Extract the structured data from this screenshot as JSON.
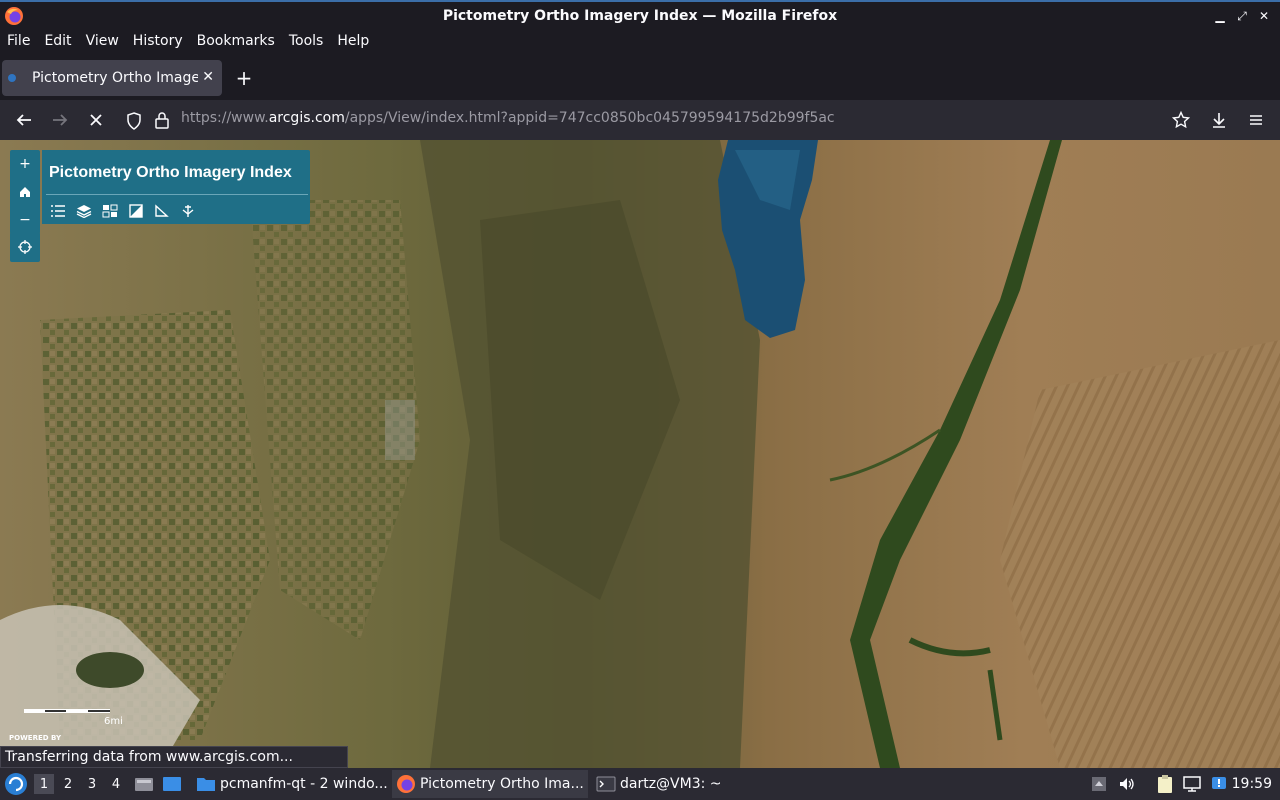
{
  "window": {
    "title": "Pictometry Ortho Imagery Index — Mozilla Firefox",
    "buttons": [
      "minimize-icon",
      "restore-icon",
      "close-icon"
    ]
  },
  "menu": [
    "File",
    "Edit",
    "View",
    "History",
    "Bookmarks",
    "Tools",
    "Help"
  ],
  "tab": {
    "label": "Pictometry Ortho Imagery Index",
    "close": "✕",
    "new_tab": "+"
  },
  "url": {
    "prefix": "https://www.",
    "host": "arcgis.com",
    "path": "/apps/View/index.html?appid=747cc0850bc045799594175d2b99f5ac"
  },
  "map": {
    "panel_title": "Pictometry Ortho Imagery Index",
    "zoom_in": "+",
    "home_icon": "home-icon",
    "zoom_out": "−",
    "tools": [
      "list-icon",
      "layers-icon",
      "basemap-gallery-icon",
      "print-icon",
      "measure-icon",
      "share-icon"
    ],
    "scale_label": "6mi",
    "powered_by": "POWERED BY",
    "colors": {
      "widget": "#1f6f87",
      "lake": "#1b4f73"
    }
  },
  "status_text": "Transferring data from www.arcgis.com...",
  "taskbar": {
    "workspaces": [
      "1",
      "2",
      "3",
      "4"
    ],
    "active_workspace": "1",
    "items": [
      {
        "label": "pcmanfm-qt - 2 windo...",
        "icon": "folder-icon"
      },
      {
        "label": "Pictometry Ortho Ima...",
        "icon": "firefox-icon"
      },
      {
        "label": "dartz@VM3: ~",
        "icon": "terminal-icon"
      }
    ],
    "clock": "19:59"
  }
}
